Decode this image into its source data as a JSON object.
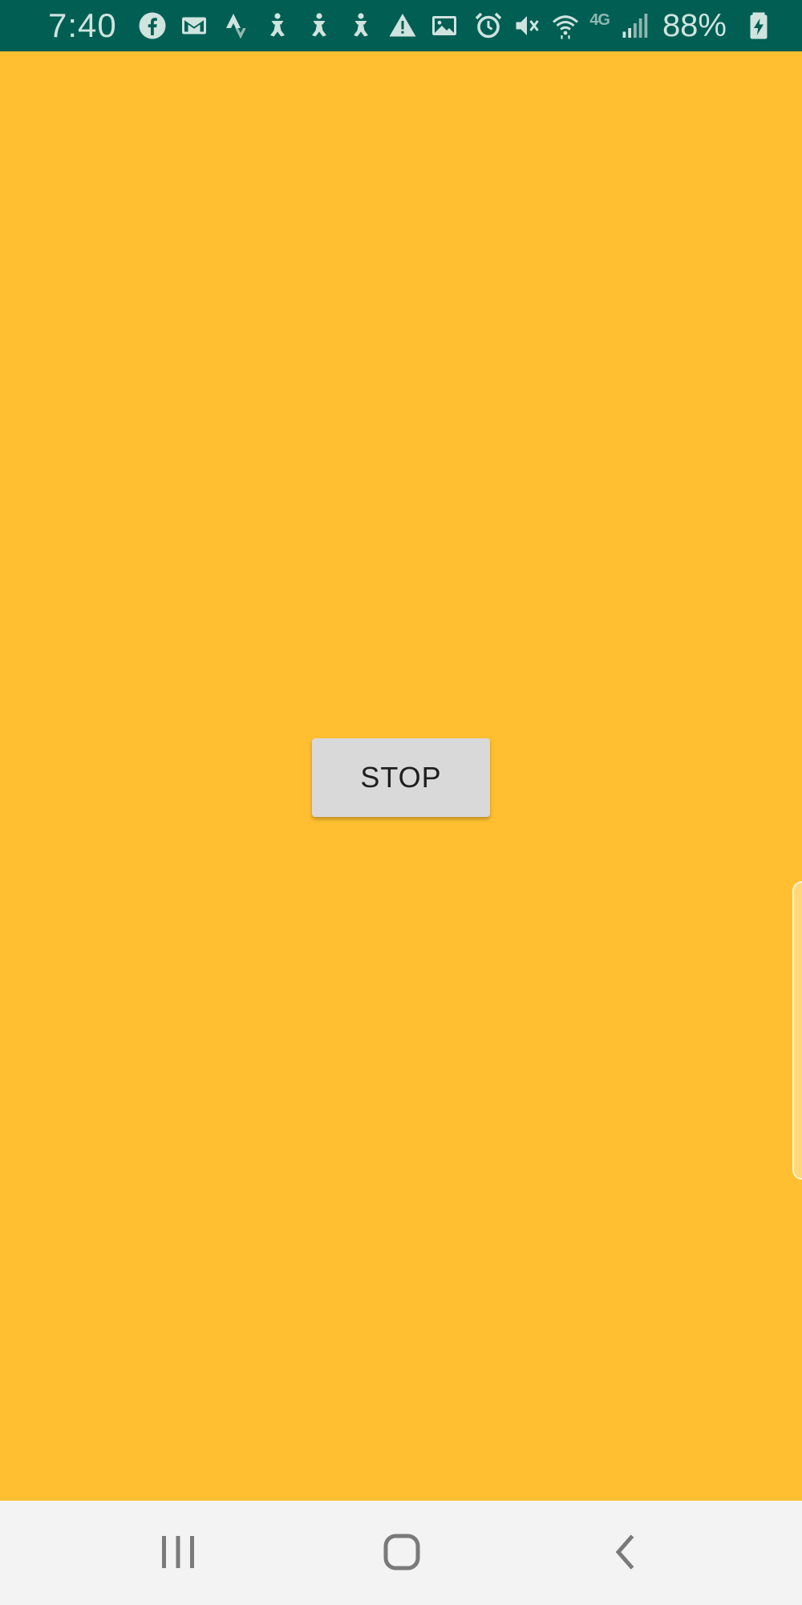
{
  "status_bar": {
    "time": "7:40",
    "battery_percent": "88%",
    "network_label": "4G",
    "background_color": "#005E53",
    "notification_icons": [
      "facebook-icon",
      "gmail-icon",
      "strava-icon",
      "accessibility-icon",
      "accessibility-icon",
      "accessibility-icon",
      "warning-icon",
      "image-icon"
    ],
    "system_icons": [
      "alarm-icon",
      "mute-icon",
      "wifi-icon",
      "signal-icon",
      "battery-charging-icon"
    ]
  },
  "main": {
    "background_color": "#FFBF30",
    "stop_button_label": "STOP"
  },
  "nav_bar": {
    "buttons": [
      "recent-apps-icon",
      "home-icon",
      "back-icon"
    ]
  }
}
